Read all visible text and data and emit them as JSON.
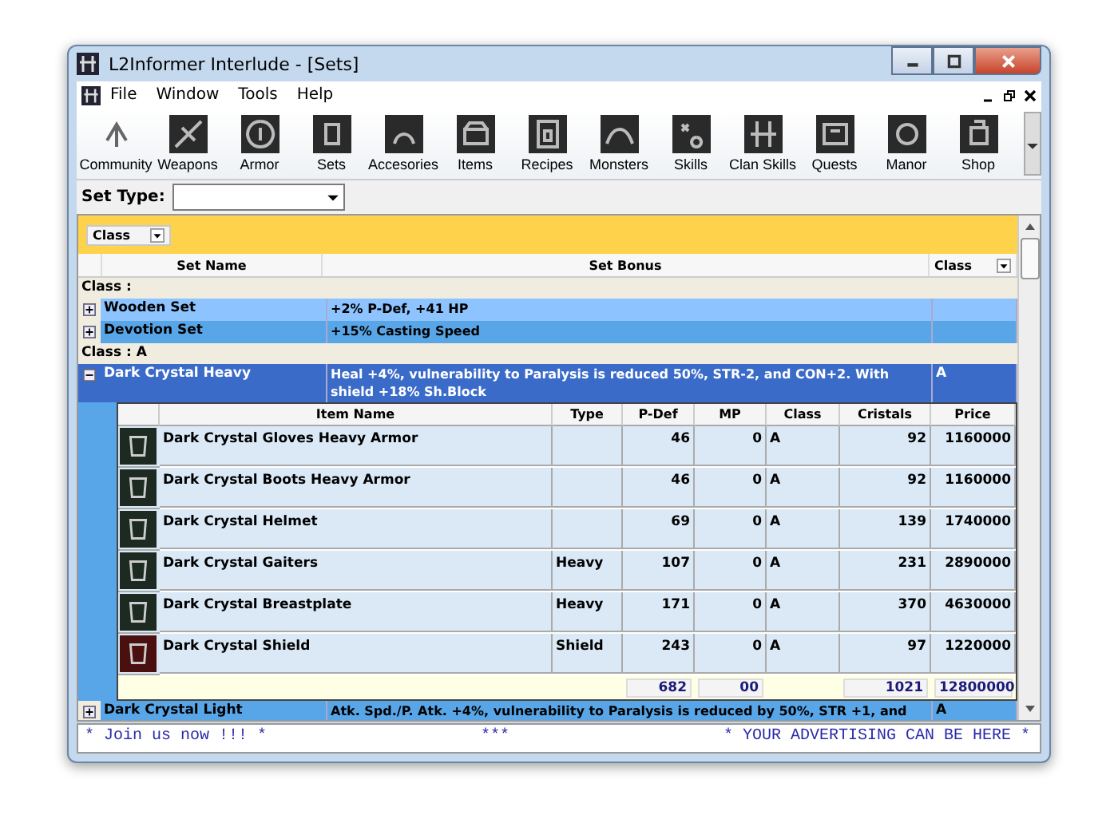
{
  "window": {
    "title": "L2Informer Interlude - [Sets]"
  },
  "menu": [
    "File",
    "Window",
    "Tools",
    "Help"
  ],
  "toolbar": [
    {
      "label": "Community"
    },
    {
      "label": "Weapons"
    },
    {
      "label": "Armor"
    },
    {
      "label": "Sets"
    },
    {
      "label": "Accesories"
    },
    {
      "label": "Items"
    },
    {
      "label": "Recipes"
    },
    {
      "label": "Monsters"
    },
    {
      "label": "Skills"
    },
    {
      "label": "Clan Skills"
    },
    {
      "label": "Quests"
    },
    {
      "label": "Manor"
    },
    {
      "label": "Shop"
    }
  ],
  "filter": {
    "label": "Set Type:"
  },
  "group_panel": {
    "chip": "Class"
  },
  "columns": [
    "Set Name",
    "Set Bonus",
    "Class"
  ],
  "groups": [
    {
      "label": "Class :",
      "sets": [
        {
          "name": "Wooden Set",
          "bonus": "+2% P-Def, +41 HP",
          "expanded": false,
          "selected": false
        },
        {
          "name": "Devotion Set",
          "bonus": "+15% Casting Speed",
          "expanded": false,
          "selected": false
        }
      ]
    },
    {
      "label": "Class : A",
      "sets": [
        {
          "name": "Dark Crystal Heavy",
          "bonus": "Heal +4%, vulnerability to Paralysis is reduced 50%, STR-2, and CON+2. With shield +18% Sh.Block",
          "class": "A",
          "expanded": true,
          "selected": true,
          "items": {
            "columns": [
              "Item Name",
              "Type",
              "P-Def",
              "MP",
              "Class",
              "Cristals",
              "Price"
            ],
            "rows": [
              [
                "Dark Crystal Gloves Heavy Armor",
                null,
                "46",
                "0",
                "A",
                "92",
                "1160000"
              ],
              [
                "Dark Crystal Boots Heavy Armor",
                null,
                "46",
                "0",
                "A",
                "92",
                "1160000"
              ],
              [
                "Dark Crystal Helmet",
                null,
                "69",
                "0",
                "A",
                "139",
                "1740000"
              ],
              [
                "Dark Crystal Gaiters",
                "Heavy",
                "107",
                "0",
                "A",
                "231",
                "2890000"
              ],
              [
                "Dark Crystal Breastplate",
                "Heavy",
                "171",
                "0",
                "A",
                "370",
                "4630000"
              ],
              [
                "Dark Crystal Shield",
                "Shield",
                "243",
                "0",
                "A",
                "97",
                "1220000"
              ]
            ],
            "totals": {
              "p_def": "682",
              "mp": "00",
              "cristals": "1021",
              "price": "12800000"
            }
          }
        },
        {
          "name": "Dark Crystal Light",
          "bonus": "Atk. Spd./P. Atk. +4%, vulnerability to Paralysis is reduced by 50%, STR +1, and",
          "class": "A",
          "expanded": false,
          "selected": false
        }
      ]
    }
  ],
  "ticker": [
    "* Join us now !!! *",
    "***",
    "* YOUR ADVERTISING CAN BE HERE *"
  ]
}
